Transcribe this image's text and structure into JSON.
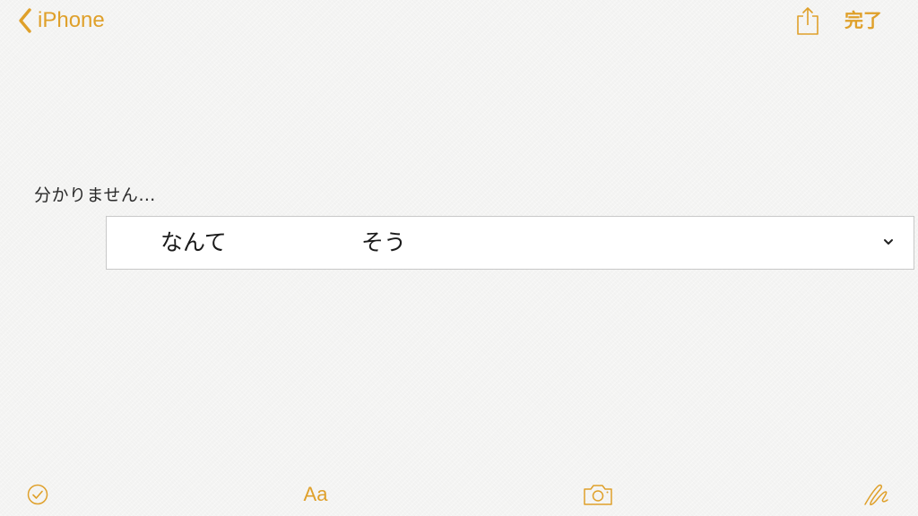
{
  "app": {
    "accent_color": "#dfa02a",
    "background_color": "#f4f4f3"
  },
  "nav": {
    "back_icon": "chevron-left-icon",
    "back_label": "iPhone",
    "share_icon": "share-icon",
    "done_label": "完了"
  },
  "note": {
    "text": "分かりません…"
  },
  "candidates": {
    "items": [
      "なんて",
      "そう"
    ],
    "expand_icon": "chevron-down-icon"
  },
  "toolbar": {
    "checklist_icon": "checkmark-circle-icon",
    "format_label": "Aa",
    "camera_icon": "camera-icon",
    "sketch_icon": "sketch-icon"
  }
}
